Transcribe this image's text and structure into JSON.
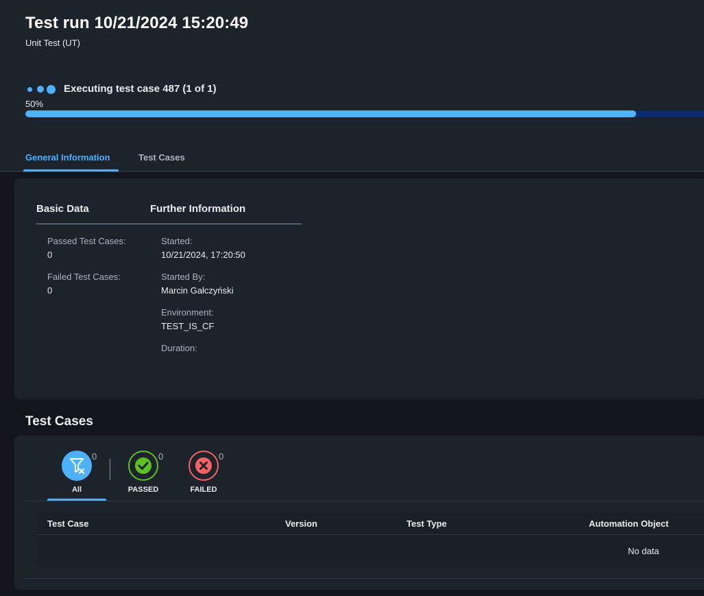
{
  "header": {
    "title": "Test run 10/21/2024 15:20:49",
    "subtitle": "Unit Test (UT)",
    "busy_indicator_icon": "busy-dots-icon",
    "executing_text": "Executing test case 487 (1 of 1)",
    "progress_percent_text": "50%",
    "progress_value": 0.9,
    "tabs": [
      {
        "label": "General Information",
        "selected": true
      },
      {
        "label": "Test Cases",
        "selected": false
      }
    ]
  },
  "basic_data": {
    "heading": "Basic Data",
    "passed_label": "Passed Test Cases:",
    "passed_value": "0",
    "failed_label": "Failed Test Cases:",
    "failed_value": "0"
  },
  "further_info": {
    "heading": "Further Information",
    "started_label": "Started:",
    "started_value": "10/21/2024, 17:20:50",
    "started_by_label": "Started By:",
    "started_by_value": "Marcin Gałczyński",
    "environment_label": "Environment:",
    "environment_value": "TEST_IS_CF",
    "duration_label": "Duration:",
    "duration_value": ""
  },
  "test_cases": {
    "heading": "Test Cases",
    "filters": [
      {
        "label": "All",
        "count": "0",
        "icon": "filter-clear-icon",
        "color": "#4db1ff",
        "selected": true
      },
      {
        "label": "PASSED",
        "count": "0",
        "icon": "check-icon",
        "color": "#5dc122",
        "selected": false
      },
      {
        "label": "FAILED",
        "count": "0",
        "icon": "error-icon",
        "color": "#fa6161",
        "selected": false
      }
    ],
    "columns": [
      "Test Case",
      "Version",
      "Test Type",
      "Automation Object"
    ],
    "empty_text": "No data"
  },
  "colors": {
    "accent": "#4db1ff",
    "background": "#12161c",
    "surface": "#1d232a",
    "success": "#5dc122",
    "error": "#fa6161"
  }
}
